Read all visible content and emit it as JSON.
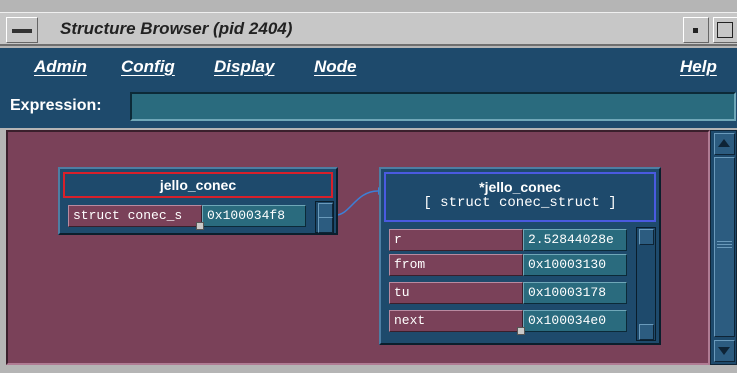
{
  "window": {
    "title": "Structure Browser (pid 2404)"
  },
  "menu": {
    "items": [
      "Admin",
      "Config",
      "Display",
      "Node",
      "Help"
    ]
  },
  "expression": {
    "label": "Expression:",
    "value": ""
  },
  "nodes": {
    "left": {
      "title": "jello_conec",
      "fields": [
        {
          "name": "struct conec_s",
          "value": "0x100034f8"
        }
      ]
    },
    "right": {
      "title": "*jello_conec",
      "subtitle": "[ struct conec_struct  ]",
      "fields": [
        {
          "name": "r",
          "value": "2.52844028e"
        },
        {
          "name": "from",
          "value": "0x10003130"
        },
        {
          "name": "tu",
          "value": "0x10003178"
        },
        {
          "name": "next",
          "value": "0x100034e0"
        }
      ]
    }
  },
  "colors": {
    "menubar": "#1e4a6c",
    "canvas": "#7a4159",
    "left_header_border": "#d8202a",
    "right_header_border": "#4a5ae0",
    "connector": "#3d7fd6"
  }
}
